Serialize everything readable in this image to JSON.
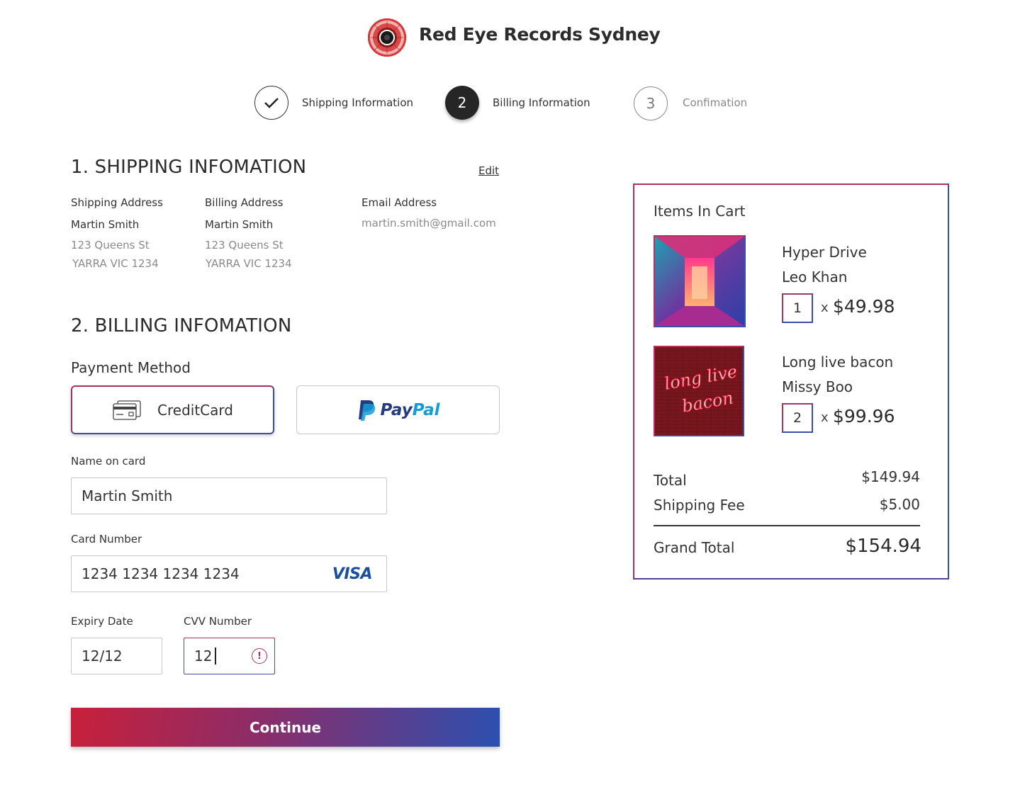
{
  "header": {
    "brand": "Red Eye Records Sydney",
    "logo_icon": "red-eye-record-logo"
  },
  "stepper": {
    "steps": [
      {
        "marker": "✓",
        "label": "Shipping Information",
        "state": "complete"
      },
      {
        "marker": "2",
        "label": "Billing Information",
        "state": "active"
      },
      {
        "marker": "3",
        "label": "Confimation",
        "state": "pending"
      }
    ]
  },
  "shipping": {
    "title": "1. SHIPPING INFOMATION",
    "edit_label": "Edit",
    "shipping_address": {
      "heading": "Shipping Address",
      "name": "Martin Smith",
      "line1": "123 Queens St",
      "line2": "YARRA VIC 1234"
    },
    "billing_address": {
      "heading": "Billing Address",
      "name": "Martin Smith",
      "line1": "123 Queens St",
      "line2": "YARRA VIC 1234"
    },
    "email": {
      "heading": "Email Address",
      "value": "martin.smith@gmail.com"
    }
  },
  "billing": {
    "title": "2. BILLING INFOMATION",
    "payment_method_label": "Payment Method",
    "creditcard_label": "CreditCard",
    "paypal_label_pay": "Pay",
    "paypal_label_pal": "Pal",
    "name_label": "Name on card",
    "name_value": "Martin Smith",
    "card_number_label": "Card Number",
    "card_number_value": "1234 1234 1234 1234",
    "card_brand": "VISA",
    "expiry_label": "Expiry Date",
    "expiry_value": "12/12",
    "cvv_label": "CVV Number",
    "cvv_value": "12",
    "cvv_error_icon": "!",
    "continue_label": "Continue"
  },
  "cart": {
    "title": "Items In Cart",
    "items": [
      {
        "title": "Hyper Drive",
        "artist": "Leo Khan",
        "qty": "1",
        "times": "x",
        "price": "$49.98"
      },
      {
        "title": "Long live bacon",
        "artist": "Missy Boo",
        "qty": "2",
        "times": "x",
        "price": "$99.96"
      }
    ],
    "neon_text_1": "long live",
    "neon_text_2": "bacon",
    "total_label": "Total",
    "total_value": "$149.94",
    "shipping_label": "Shipping Fee",
    "shipping_value": "$5.00",
    "grand_label": "Grand Total",
    "grand_value": "$154.94"
  },
  "colors": {
    "accent_red": "#c8203a",
    "accent_blue": "#2c50b0",
    "paypal_dark": "#253b80",
    "paypal_light": "#179bd7",
    "visa_blue": "#1a4fa0"
  }
}
